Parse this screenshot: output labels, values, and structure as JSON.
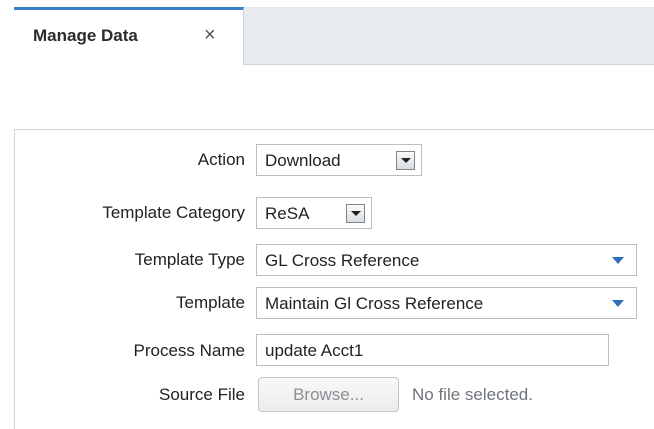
{
  "tabs": [
    {
      "label": "Manage Data",
      "close_glyph": "×",
      "active": true
    }
  ],
  "icons": {
    "tab_close": "close-icon",
    "dropdown": "chevron-down-icon"
  },
  "colors": {
    "tab_accent": "#3a7dc9",
    "dropdown_arrow": "#2e6fb6",
    "tabbar_bg": "#e8ebee"
  },
  "form": {
    "action": {
      "label": "Action",
      "value": "Download"
    },
    "template_category": {
      "label": "Template Category",
      "value": "ReSA"
    },
    "template_type": {
      "label": "Template Type",
      "value": "GL Cross Reference"
    },
    "template": {
      "label": "Template",
      "value": "Maintain Gl Cross Reference"
    },
    "process_name": {
      "label": "Process Name",
      "value": "update Acct1"
    },
    "source_file": {
      "label": "Source File",
      "button_label": "Browse...",
      "status": "No file selected."
    }
  }
}
